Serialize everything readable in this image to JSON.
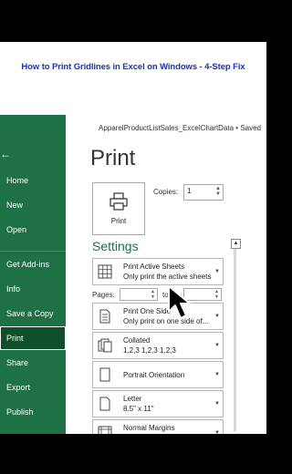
{
  "banner": {
    "title": "How to Print Gridlines in Excel on Windows - 4-Step Fix"
  },
  "window": {
    "document_title": "ApparelProductListSales_ExcelChartData • Saved"
  },
  "sidebar": {
    "back_icon": "←",
    "items": [
      {
        "label": "Home"
      },
      {
        "label": "New"
      },
      {
        "label": "Open"
      },
      {
        "label": "Get Add-ins"
      },
      {
        "label": "Info"
      },
      {
        "label": "Save a Copy"
      },
      {
        "label": "Print"
      },
      {
        "label": "Share"
      },
      {
        "label": "Export"
      },
      {
        "label": "Publish"
      }
    ],
    "active_item": "Print",
    "colors": {
      "background": "#1e7145",
      "active": "#0f4f2c"
    }
  },
  "print": {
    "heading": "Print",
    "button_label": "Print",
    "button_icon": "printer-icon",
    "copies_label": "Copies:",
    "copies_value": "1"
  },
  "settings": {
    "heading": "Settings",
    "pages_label": "Pages:",
    "pages_to": "to",
    "options": [
      {
        "icon": "sheet-grid-icon",
        "line1": "Print Active Sheets",
        "line2": "Only print the active sheets"
      },
      {
        "icon": "one-sided-icon",
        "line1": "Print One Side",
        "line2": "Only print on one side of..."
      },
      {
        "icon": "collated-icon",
        "line1": "Collated",
        "line2": "1,2,3    1,2,3    1,2,3"
      },
      {
        "icon": "portrait-icon",
        "line1": "Portrait Orientation",
        "line2": ""
      },
      {
        "icon": "letter-paper-icon",
        "line1": "Letter",
        "line2": "8.5\" x 11\""
      },
      {
        "icon": "margins-icon",
        "line1": "Normal Margins",
        "line2": ""
      }
    ]
  }
}
